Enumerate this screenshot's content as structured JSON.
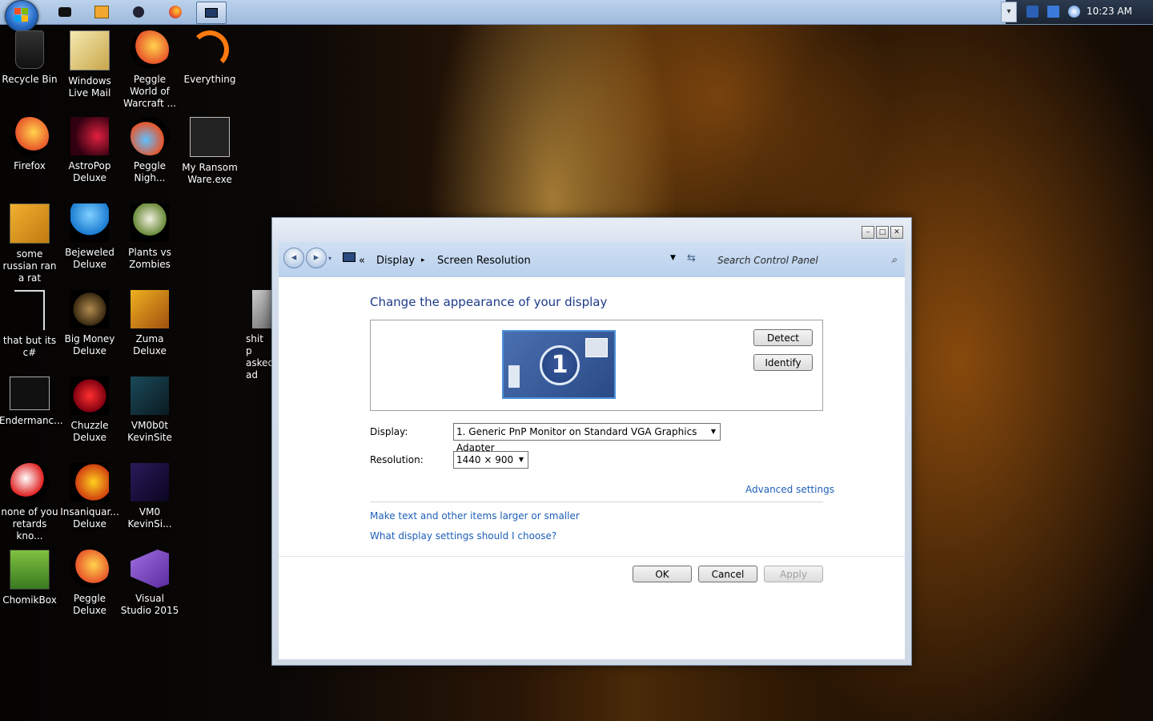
{
  "taskbar": {
    "clock": "10:23 AM"
  },
  "desktop": {
    "icons": [
      {
        "label": "Recycle Bin"
      },
      {
        "label": "Windows Live Mail"
      },
      {
        "label": "Peggle World of Warcraft ..."
      },
      {
        "label": "Everything"
      },
      {
        "label": "Firefox"
      },
      {
        "label": "AstroPop Deluxe"
      },
      {
        "label": "Peggle Nigh..."
      },
      {
        "label": "My Ransom Ware.exe"
      },
      {
        "label": "some russian ran a rat"
      },
      {
        "label": "Bejeweled Deluxe"
      },
      {
        "label": "Plants vs Zombies"
      },
      {
        "label": "that but its c#"
      },
      {
        "label": "Big Money Deluxe"
      },
      {
        "label": "Zuma Deluxe"
      },
      {
        "label": "shit p asked ad"
      },
      {
        "label": "Endermanc..."
      },
      {
        "label": "Chuzzle Deluxe"
      },
      {
        "label": "VM0b0t KevinSite"
      },
      {
        "label": "none of you retards kno..."
      },
      {
        "label": "Insaniquar... Deluxe"
      },
      {
        "label": "VM0 KevinSi..."
      },
      {
        "label": "ChomikBox"
      },
      {
        "label": "Peggle Deluxe"
      },
      {
        "label": "Visual Studio 2015"
      }
    ]
  },
  "window": {
    "breadcrumb": {
      "overflow": "«",
      "display": "Display",
      "separator": "▸",
      "current": "Screen Resolution"
    },
    "search": {
      "placeholder": "Search Control Panel"
    },
    "title": "Change the appearance of your display",
    "monitor_number": "1",
    "detect": "Detect",
    "identify": "Identify",
    "display_label": "Display:",
    "display_value": "1. Generic PnP Monitor on Standard VGA Graphics Adapter",
    "resolution_label": "Resolution:",
    "resolution_value": "1440 × 900",
    "advanced": "Advanced settings",
    "link_text_size": "Make text and other items larger or smaller",
    "link_choose": "What display settings should I choose?",
    "ok": "OK",
    "cancel": "Cancel",
    "apply": "Apply"
  },
  "colors": {
    "link": "#1e5fb8",
    "title": "#1e3b8a",
    "taskbar": "#9db9dc"
  }
}
